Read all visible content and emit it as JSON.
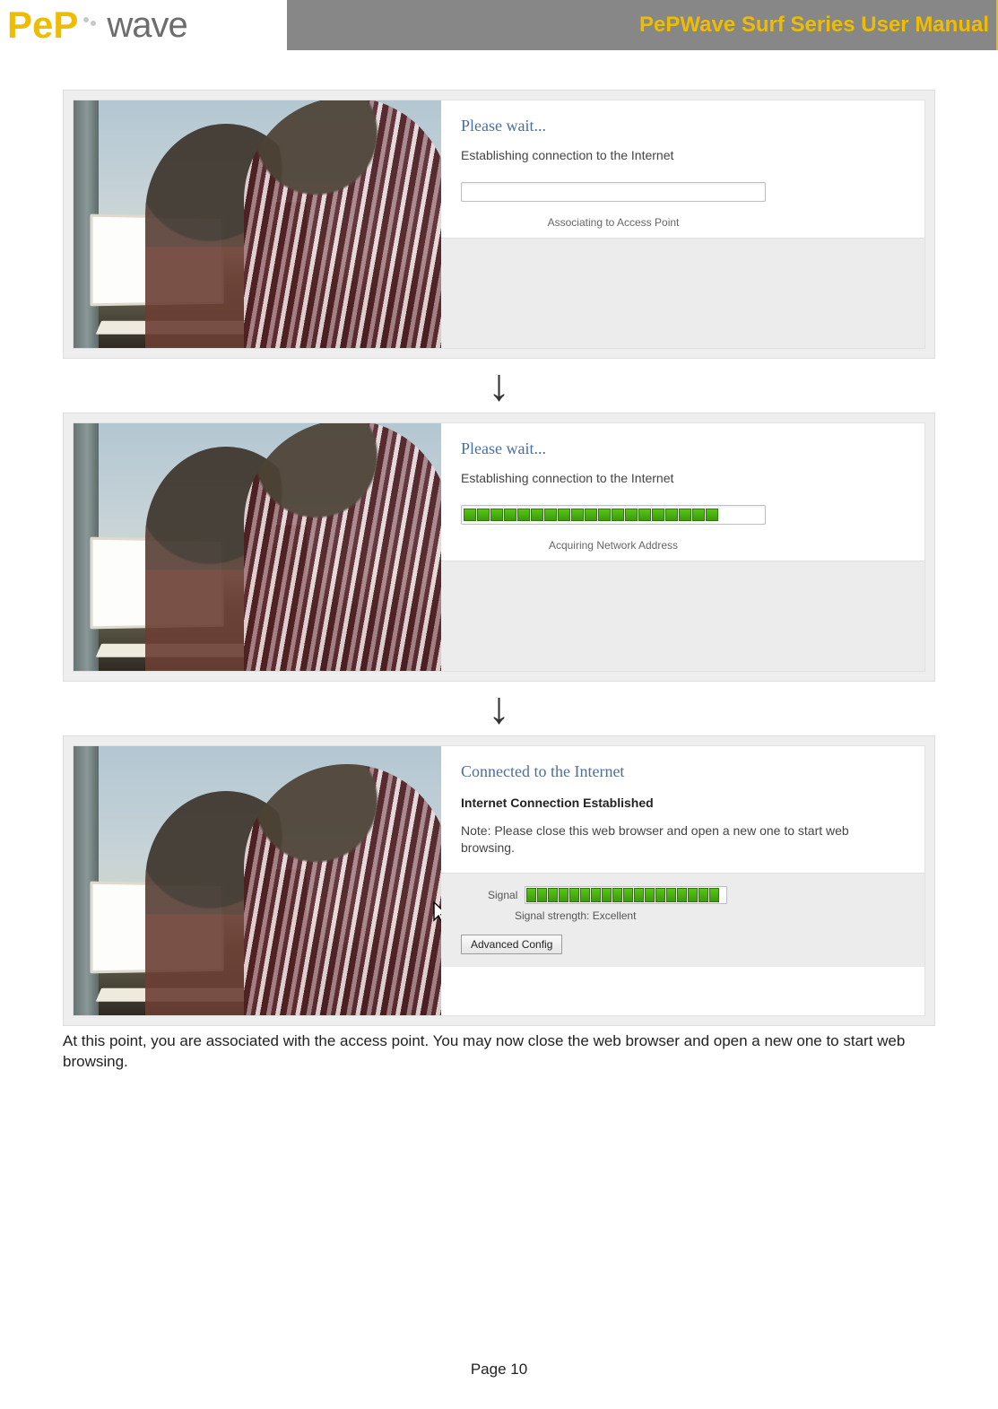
{
  "header": {
    "brand_pep": "PeP",
    "brand_wave": "wave",
    "doc_title": "PePWave Surf Series User Manual"
  },
  "panel1": {
    "title": "Please wait...",
    "subtitle": "Establishing connection to the Internet",
    "progress_segments": 0,
    "caption": "Associating to Access Point"
  },
  "panel2": {
    "title": "Please wait...",
    "subtitle": "Establishing connection to the Internet",
    "progress_segments": 19,
    "caption": "Acquiring Network Address"
  },
  "panel3": {
    "title": "Connected to the Internet",
    "established": "Internet Connection Established",
    "note": "Note: Please close this web browser and open a new one to start web browsing.",
    "signal_label": "Signal",
    "signal_segments": 18,
    "signal_caption": "Signal strength: Excellent",
    "advanced_button": "Advanced Config"
  },
  "body_paragraph": "At this point, you are associated with the access point.  You may now close the web browser and open a new one to start web browsing.",
  "footer": {
    "page_label": "Page 10"
  }
}
